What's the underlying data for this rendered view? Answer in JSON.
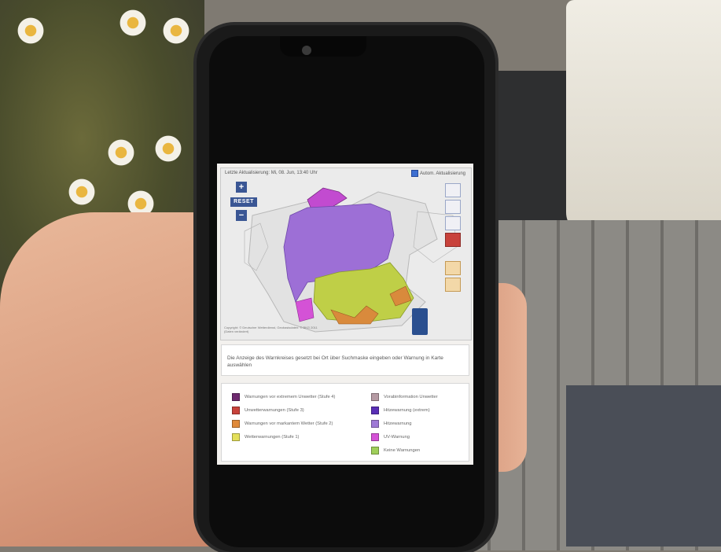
{
  "map": {
    "last_update": "Letzte Aktualisierung: Mi, 08. Jun, 13:40 Uhr",
    "auto_refresh_label": "Autom. Aktualisierung",
    "reset_label": "RESET",
    "zoom_in_label": "+",
    "zoom_out_label": "−",
    "copyright": "Copyright: © Deutscher Wetterdienst, Geobasisdaten: © BKG 2011 (Daten verändert)",
    "colors": {
      "land": "#e2e2e2",
      "purple_warning": "#9d6fd6",
      "yellow_green": "#bfcf47",
      "orange": "#d98a3c",
      "magenta": "#c24bd0"
    }
  },
  "hint": "Die Anzeige des Warnkreises gesetzt bei Ort über Suchmaske eingeben oder Warnung in Karte auswählen",
  "legend": {
    "items": [
      {
        "label": "Warnungen vor extremem Unwetter (Stufe 4)",
        "color": "#6e2a6f"
      },
      {
        "label": "Unwetterwarnungen (Stufe 3)",
        "color": "#c8423b"
      },
      {
        "label": "Warnungen vor markantem Wetter (Stufe 2)",
        "color": "#e08a3a"
      },
      {
        "label": "Wetterwarnungen (Stufe 1)",
        "color": "#e3df5a"
      },
      {
        "label": "Vorabinformation Unwetter",
        "color": "#b59aa3"
      },
      {
        "label": "Hitzewarnung (extrem)",
        "color": "#5a2fb6"
      },
      {
        "label": "Hitzewarnung",
        "color": "#9f7ad6"
      },
      {
        "label": "UV-Warnung",
        "color": "#d452d6"
      },
      {
        "label": "Keine Warnungen",
        "color": "#9fcf5a"
      }
    ]
  }
}
